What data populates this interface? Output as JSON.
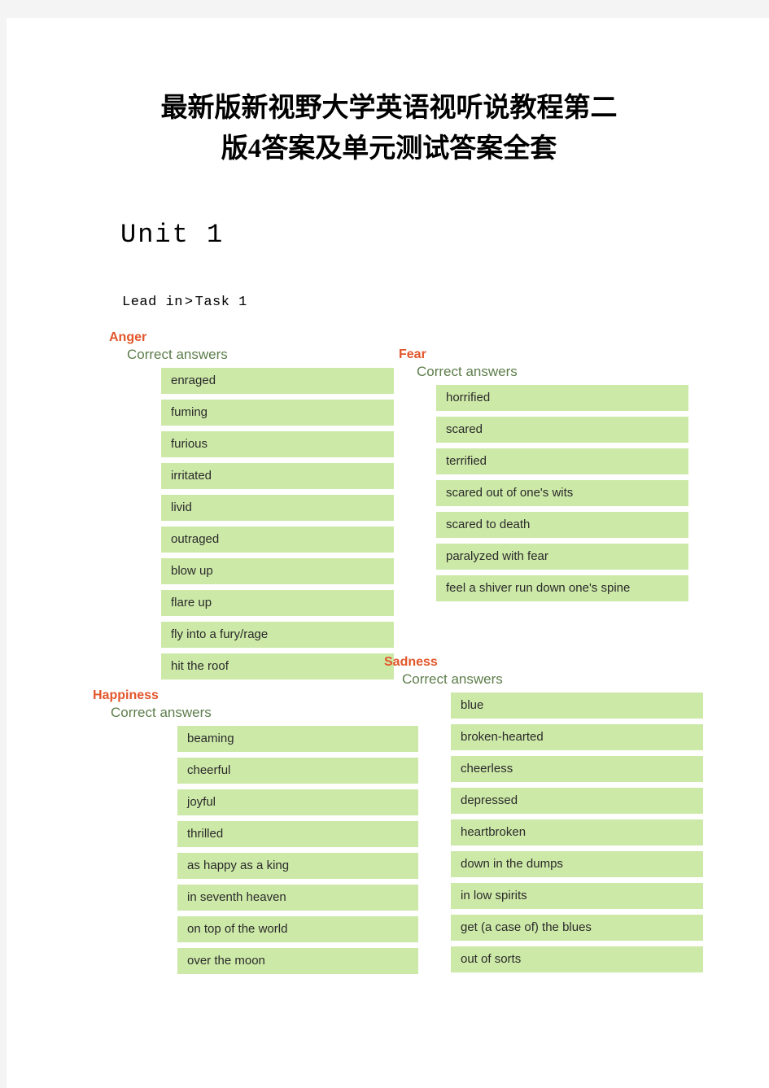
{
  "document": {
    "title_line_1": "最新版新视野大学英语视听说教程第二",
    "title_line_2": "版4答案及单元测试答案全套",
    "unit_heading": "Unit 1",
    "breadcrumb": {
      "section": "Lead in",
      "separator": ">",
      "task": "Task 1"
    }
  },
  "colors": {
    "group_title": "#e2562a",
    "subtitle": "#5d7d4b",
    "answer_background": "#cde9a8",
    "answer_text": "#2a2a2a",
    "page_background": "#ffffff",
    "backdrop": "#f4f4f4"
  },
  "groups": [
    {
      "title": "Anger",
      "subtitle": "Correct answers",
      "answers": [
        "enraged",
        "fuming",
        "furious",
        "irritated",
        "livid",
        "outraged",
        "blow up",
        "flare up",
        "fly into a fury/rage",
        "hit the roof"
      ]
    },
    {
      "title": "Happiness",
      "subtitle": "Correct answers",
      "answers": [
        "beaming",
        "cheerful",
        "joyful",
        "thrilled",
        "as happy as a king",
        "in seventh heaven",
        "on top of the world",
        "over the moon"
      ]
    },
    {
      "title": "Fear",
      "subtitle": "Correct answers",
      "answers": [
        "horrified",
        "scared",
        "terrified",
        "scared out of one's wits",
        "scared to death",
        "paralyzed with fear",
        "feel a shiver run down one's spine"
      ]
    },
    {
      "title": "Sadness",
      "subtitle": "Correct answers",
      "answers": [
        "blue",
        "broken-hearted",
        "cheerless",
        "depressed",
        "heartbroken",
        "down in the dumps",
        "in low spirits",
        "get (a case of) the blues",
        "out of sorts"
      ]
    }
  ]
}
